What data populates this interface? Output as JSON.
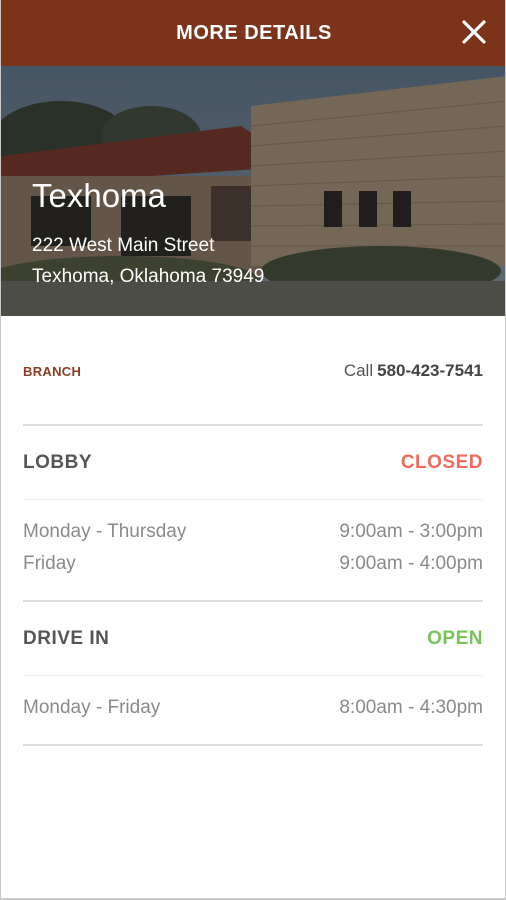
{
  "header": {
    "title": "MORE DETAILS",
    "close_icon": "close-icon"
  },
  "location": {
    "name": "Texhoma",
    "address_line1": "222 West Main Street",
    "address_line2": "Texhoma, Oklahoma 73949"
  },
  "branch": {
    "label": "BRANCH",
    "call_prefix": "Call",
    "phone": "580-423-7541"
  },
  "lobby": {
    "title": "LOBBY",
    "status": "CLOSED",
    "hours": [
      {
        "days": "Monday - Thursday",
        "time": "9:00am - 3:00pm"
      },
      {
        "days": "Friday",
        "time": "9:00am - 4:00pm"
      }
    ]
  },
  "drive_in": {
    "title": "DRIVE IN",
    "status": "OPEN",
    "hours": [
      {
        "days": "Monday - Friday",
        "time": "8:00am - 4:30pm"
      }
    ]
  },
  "colors": {
    "header_bg": "#7b3319",
    "branch_label": "#8e3b22",
    "closed": "#f06a5d",
    "open": "#76c35a"
  }
}
